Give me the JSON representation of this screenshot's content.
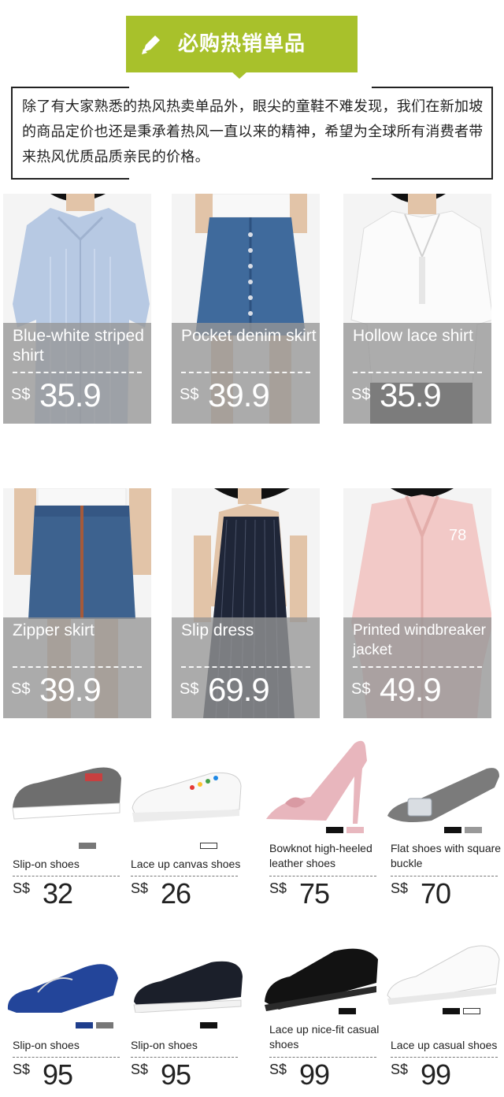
{
  "banner": {
    "title": "必购热销单品",
    "icon": "pencil-icon",
    "color": "#a8c12b"
  },
  "intro": {
    "text": "除了有大家熟悉的热风热卖单品外，眼尖的童鞋不难发现，我们在新加坡的商品定价也还是秉承着热风一直以来的精神，希望为全球所有消费者带来热风优质品质亲民的价格。"
  },
  "apparel": [
    {
      "name": "Blue-white striped shirt",
      "currency": "S$",
      "price": "35.9"
    },
    {
      "name": "Pocket denim skirt",
      "currency": "S$",
      "price": "39.9"
    },
    {
      "name": "Hollow lace shirt",
      "currency": "S$",
      "price": "35.9"
    },
    {
      "name": "Zipper skirt",
      "currency": "S$",
      "price": "39.9"
    },
    {
      "name": "Slip dress",
      "currency": "S$",
      "price": "69.9"
    },
    {
      "name": "Printed windbreaker jacket",
      "currency": "S$",
      "price": "49.9"
    }
  ],
  "shoes": [
    {
      "name": "Slip-on shoes",
      "currency": "S$",
      "price": "32",
      "swatches": [
        "#777777"
      ]
    },
    {
      "name": "Lace up canvas shoes",
      "currency": "S$",
      "price": "26",
      "swatches": [
        "#ffffff"
      ]
    },
    {
      "name": "Bowknot high-heeled leather shoes",
      "currency": "S$",
      "price": "75",
      "swatches": [
        "#111111",
        "#e8b8bf"
      ]
    },
    {
      "name": "Flat shoes with square buckle",
      "currency": "S$",
      "price": "70",
      "swatches": [
        "#111111",
        "#999999"
      ]
    },
    {
      "name": "Slip-on shoes",
      "currency": "S$",
      "price": "95",
      "swatches": [
        "#1f3e8c",
        "#777777"
      ]
    },
    {
      "name": "Slip-on shoes",
      "currency": "S$",
      "price": "95",
      "swatches": [
        "#111111"
      ]
    },
    {
      "name": "Lace up nice-fit casual shoes",
      "currency": "S$",
      "price": "99",
      "swatches": [
        "#111111"
      ]
    },
    {
      "name": "Lace up casual shoes",
      "currency": "S$",
      "price": "99",
      "swatches": [
        "#111111",
        "#ffffff"
      ]
    }
  ]
}
